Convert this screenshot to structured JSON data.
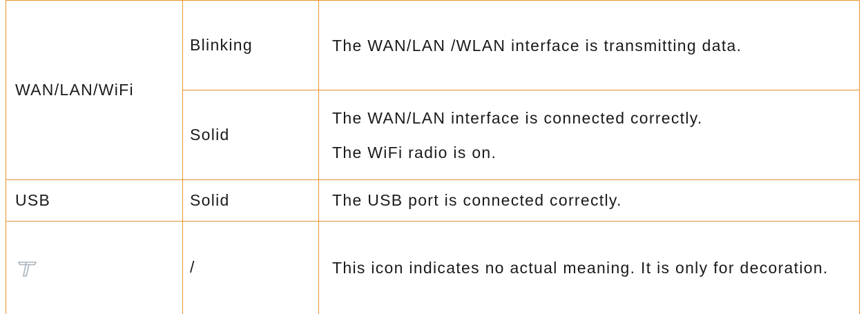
{
  "table": {
    "rows": [
      {
        "led": "WAN/LAN/WiFi",
        "states": [
          {
            "status": "Blinking",
            "description": [
              "The WAN/LAN /WLAN interface is transmitting data."
            ]
          },
          {
            "status": "Solid",
            "description": [
              "The WAN/LAN interface is connected correctly.",
              "The WiFi radio is on."
            ]
          }
        ]
      },
      {
        "led": "USB",
        "states": [
          {
            "status": "Solid",
            "description": [
              "The USB port is connected correctly."
            ]
          }
        ]
      },
      {
        "led_icon": "decorative-t-logo-icon",
        "states": [
          {
            "status": "/",
            "description": [
              "This icon indicates no actual meaning. It is only for decoration."
            ]
          }
        ]
      }
    ]
  },
  "colors": {
    "border": "#e6922e",
    "text": "#1a1a1a",
    "icon_stroke": "#a9b3bc"
  }
}
